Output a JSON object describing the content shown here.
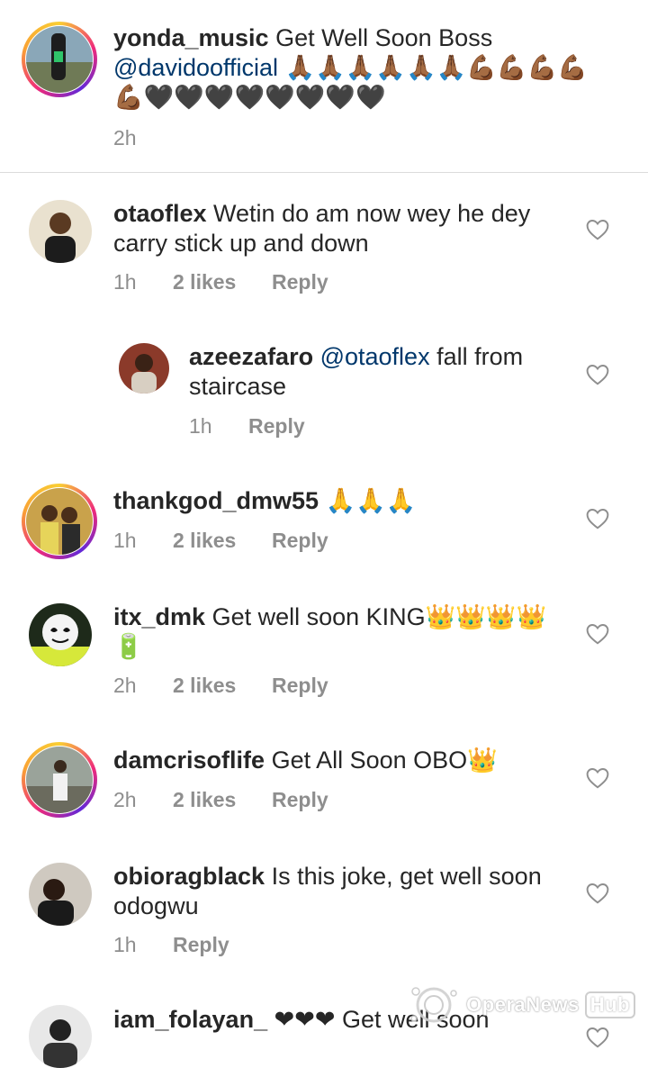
{
  "comments": [
    {
      "username": "yonda_music",
      "text": "Get Well Soon Boss",
      "mention": "@davidoofficial",
      "emoji_line": "🙏🏾🙏🏾🙏🏾🙏🏾🙏🏾🙏🏾💪🏾💪🏾💪🏾💪🏾💪🏾🖤🖤🖤🖤🖤🖤🖤🖤",
      "time": "2h"
    },
    {
      "username": "otaoflex",
      "text": "Wetin do am now wey he dey carry stick up and down",
      "time": "1h",
      "likes": "2 likes",
      "reply": "Reply"
    },
    {
      "username": "azeezafaro",
      "mention": "@otaoflex",
      "text": "fall from staircase",
      "time": "1h",
      "reply": "Reply"
    },
    {
      "username": "thankgod_dmw55",
      "text": "🙏🙏🙏",
      "time": "1h",
      "likes": "2 likes",
      "reply": "Reply"
    },
    {
      "username": "itx_dmk",
      "text": "Get well soon KING👑👑👑👑",
      "text2": "🔋",
      "time": "2h",
      "likes": "2 likes",
      "reply": "Reply"
    },
    {
      "username": "damcrisoflife",
      "text": "Get All Soon OBO👑",
      "time": "2h",
      "likes": "2 likes",
      "reply": "Reply"
    },
    {
      "username": "obioragblack",
      "text": "Is this joke, get well soon odogwu",
      "time": "1h",
      "reply": "Reply"
    },
    {
      "username": "iam_folayan_",
      "text": "❤❤❤ Get well soon"
    }
  ],
  "watermark": {
    "brand": "OperaNews",
    "suffix": "Hub"
  },
  "colors": {
    "mention": "#00376b",
    "meta": "#8e8e8e",
    "heart_red": "#ed1c24"
  }
}
